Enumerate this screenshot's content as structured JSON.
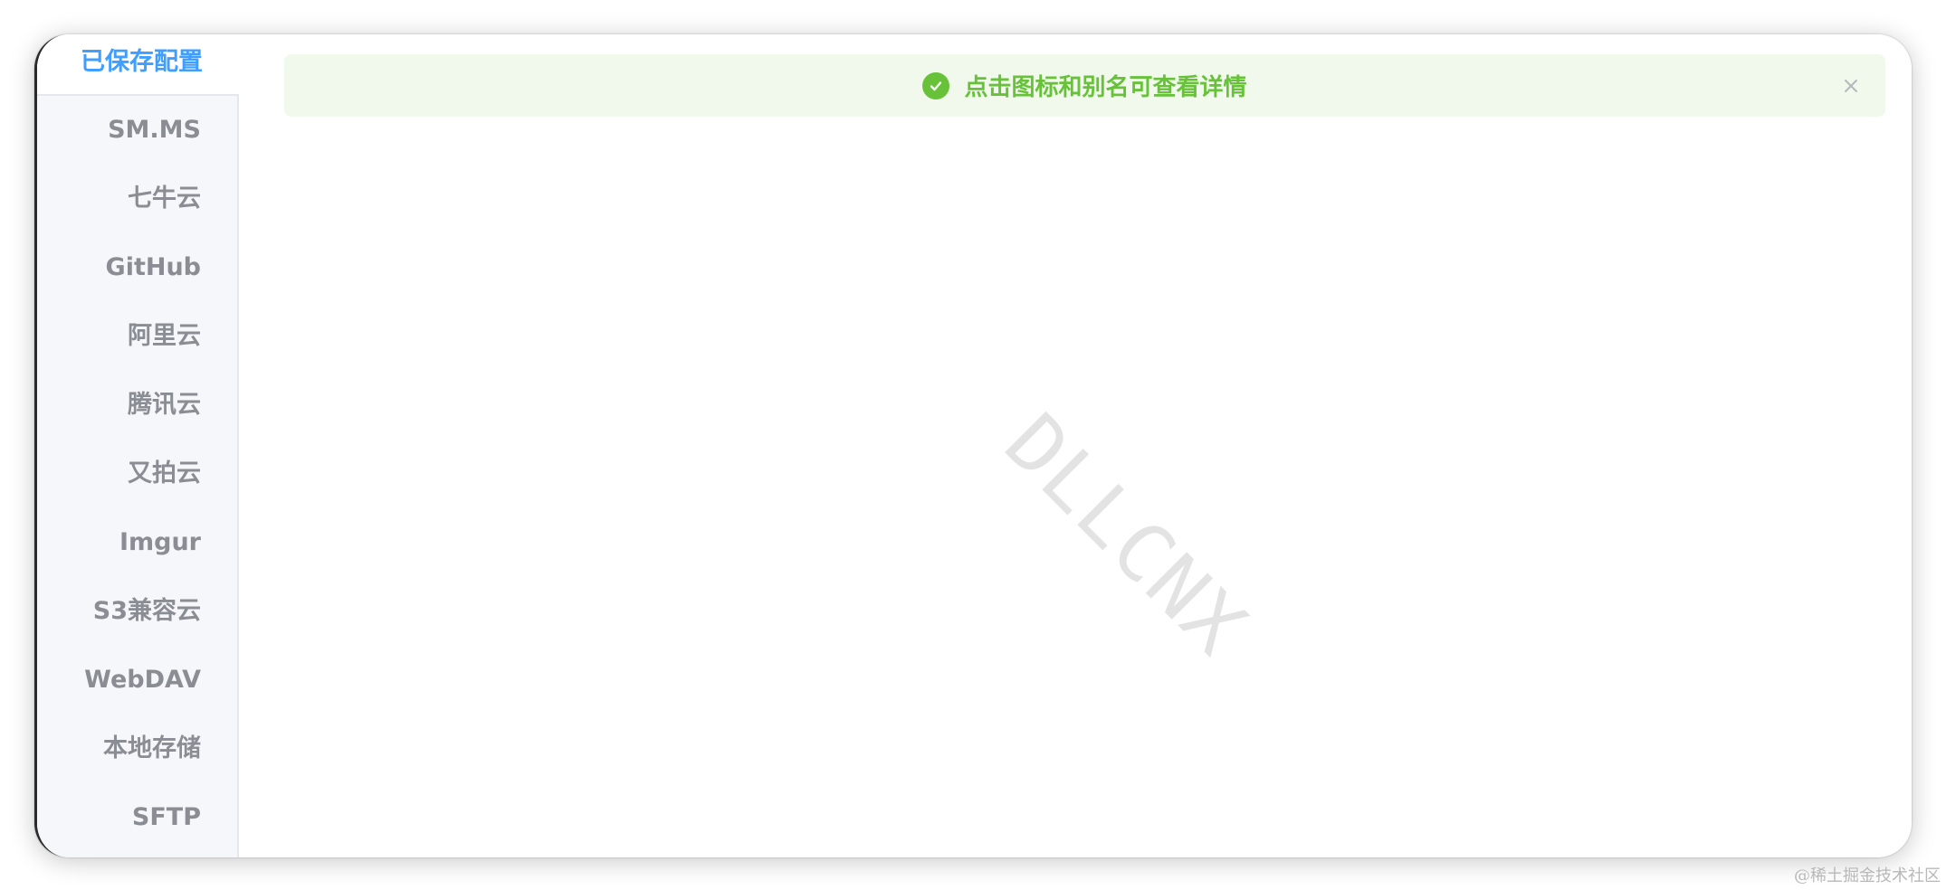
{
  "sidebar": {
    "tabs": [
      {
        "label": "已保存配置",
        "active": true
      },
      {
        "label": "SM.MS",
        "active": false
      },
      {
        "label": "七牛云",
        "active": false
      },
      {
        "label": "GitHub",
        "active": false
      },
      {
        "label": "阿里云",
        "active": false
      },
      {
        "label": "腾讯云",
        "active": false
      },
      {
        "label": "又拍云",
        "active": false
      },
      {
        "label": "Imgur",
        "active": false
      },
      {
        "label": "S3兼容云",
        "active": false
      },
      {
        "label": "WebDAV",
        "active": false
      },
      {
        "label": "本地存储",
        "active": false
      },
      {
        "label": "SFTP",
        "active": false
      }
    ]
  },
  "alert": {
    "text": "点击图标和别名可查看详情",
    "icon": "check-circle-icon",
    "close_icon": "close-icon",
    "type": "success"
  },
  "watermark": {
    "text": "DLLCNX"
  },
  "credit": {
    "text": "@稀土掘金技术社区"
  },
  "colors": {
    "accent": "#409eff",
    "success": "#67c23a",
    "success_bg": "#f0f9eb",
    "tab_text": "#8a8d93",
    "sidebar_bg": "#f5f7fa"
  }
}
